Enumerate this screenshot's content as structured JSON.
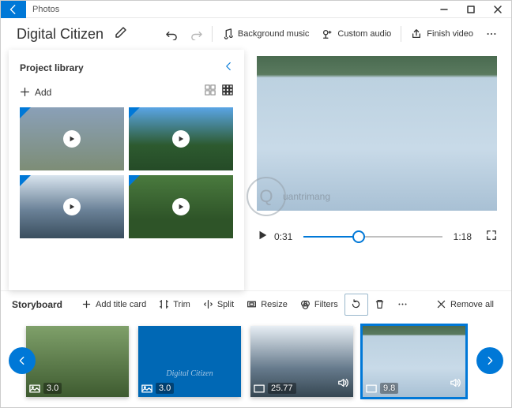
{
  "app": {
    "title": "Photos"
  },
  "project": {
    "name": "Digital Citizen"
  },
  "toolbar": {
    "bg_music": "Background music",
    "custom_audio": "Custom audio",
    "finish": "Finish video"
  },
  "library": {
    "title": "Project library",
    "add_label": "Add"
  },
  "player": {
    "current": "0:31",
    "total": "1:18"
  },
  "storyboard": {
    "title": "Storyboard",
    "add_title": "Add title card",
    "trim": "Trim",
    "split": "Split",
    "resize": "Resize",
    "filters": "Filters",
    "remove_all": "Remove all",
    "clips": [
      {
        "duration": "3.0"
      },
      {
        "duration": "3.0",
        "caption": "Digital Citizen"
      },
      {
        "duration": "25.77"
      },
      {
        "duration": "9.8"
      }
    ]
  }
}
